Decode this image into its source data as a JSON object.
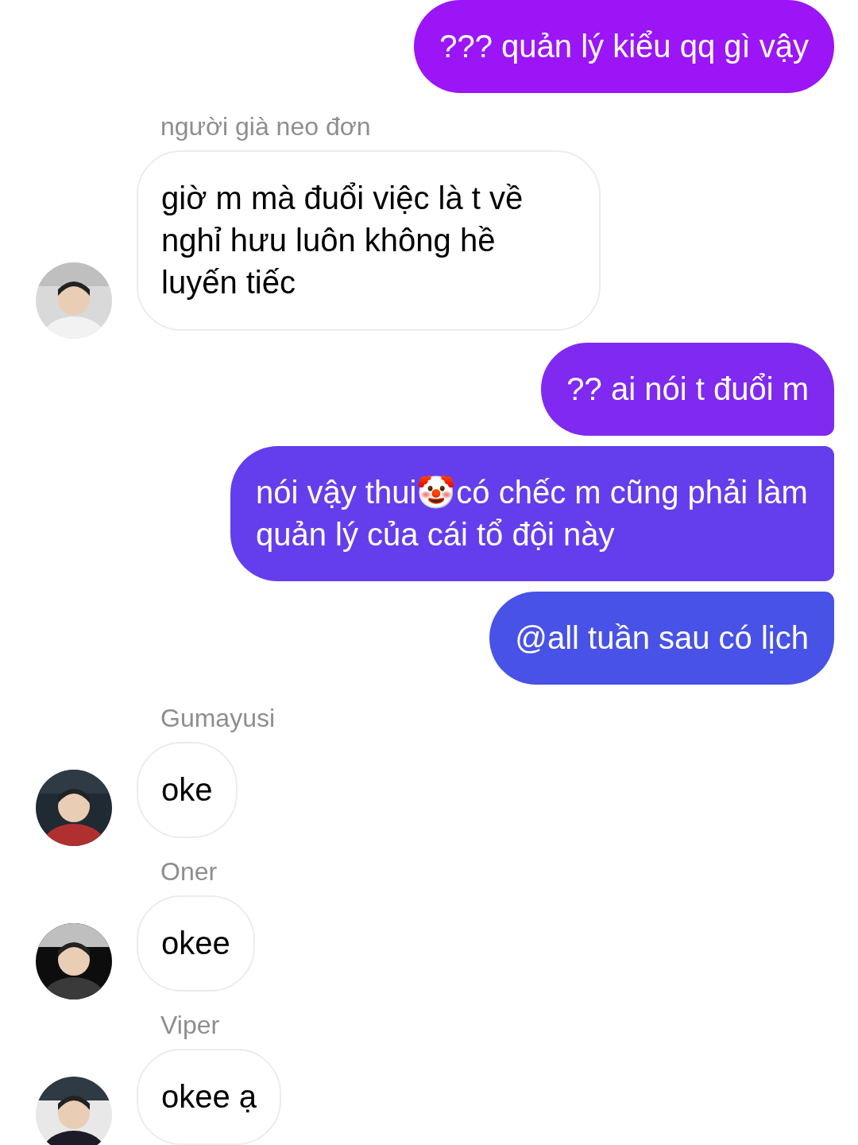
{
  "messages": [
    {
      "kind": "outgoing",
      "text": "??? quản lý kiểu qq gì vậy"
    },
    {
      "kind": "incoming",
      "sender": "người già neo đơn",
      "text": "giờ m mà đuổi việc là t về nghỉ hưu luôn không hề luyến tiếc"
    },
    {
      "kind": "outgoing",
      "text": "?? ai nói t đuổi m"
    },
    {
      "kind": "outgoing",
      "text": "nói vậy thui🤡có chếc m cũng phải làm quản lý của cái tổ đội này"
    },
    {
      "kind": "outgoing",
      "text": "@all tuần sau có lịch"
    },
    {
      "kind": "incoming",
      "sender": "Gumayusi",
      "text": "oke"
    },
    {
      "kind": "incoming",
      "sender": "Oner",
      "text": "okee"
    },
    {
      "kind": "incoming",
      "sender": "Viper",
      "text": "okee ạ"
    }
  ]
}
